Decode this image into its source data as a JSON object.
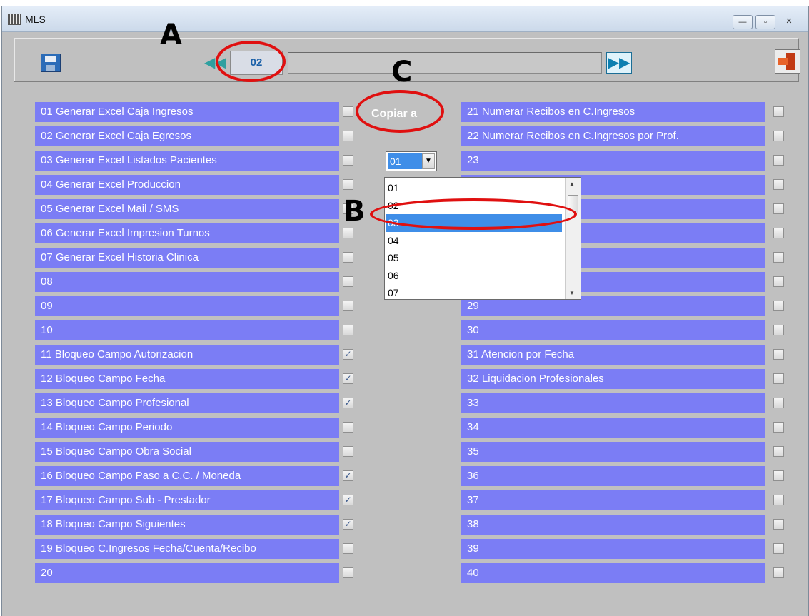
{
  "window": {
    "title": "MLS",
    "minimize_glyph": "—",
    "maximize_glyph": "▫",
    "close_glyph": "✕"
  },
  "toolbar": {
    "record": "02",
    "prev_glyph": "◀◀",
    "next_glyph": "▶▶",
    "icons": {
      "save": "save-icon",
      "prev": "rewind-icon",
      "next": "fast-forward-icon",
      "exit": "exit-door-icon"
    }
  },
  "annotations": {
    "a": "A",
    "b": "B",
    "c": "C",
    "color": "#e01010"
  },
  "copy": {
    "label": "Copiar a",
    "selected": "01",
    "options": [
      "01",
      "02",
      "03",
      "04",
      "05",
      "06",
      "07"
    ],
    "highlighted_option": "03"
  },
  "left_items": [
    {
      "label": "01 Generar Excel Caja Ingresos",
      "checked": false
    },
    {
      "label": "02 Generar Excel Caja Egresos",
      "checked": false
    },
    {
      "label": "03 Generar Excel Listados Pacientes",
      "checked": false
    },
    {
      "label": "04 Generar Excel Produccion",
      "checked": false
    },
    {
      "label": "05 Generar Excel Mail / SMS",
      "checked": false
    },
    {
      "label": "06 Generar Excel Impresion Turnos",
      "checked": false
    },
    {
      "label": "07 Generar Excel Historia Clinica",
      "checked": false
    },
    {
      "label": "08",
      "checked": false
    },
    {
      "label": "09",
      "checked": false
    },
    {
      "label": "10",
      "checked": false
    },
    {
      "label": "11 Bloqueo Campo Autorizacion",
      "checked": true
    },
    {
      "label": "12 Bloqueo Campo Fecha",
      "checked": true
    },
    {
      "label": "13 Bloqueo Campo Profesional",
      "checked": true
    },
    {
      "label": "14 Bloqueo Campo Periodo",
      "checked": false
    },
    {
      "label": "15 Bloqueo Campo Obra Social",
      "checked": false
    },
    {
      "label": "16 Bloqueo Campo Paso a C.C. / Moneda",
      "checked": true
    },
    {
      "label": "17 Bloqueo Campo Sub - Prestador",
      "checked": true
    },
    {
      "label": "18 Bloqueo Campo Siguientes",
      "checked": true
    },
    {
      "label": "19 Bloqueo C.Ingresos Fecha/Cuenta/Recibo",
      "checked": false
    },
    {
      "label": "20",
      "checked": false
    }
  ],
  "right_items": [
    {
      "label": "21 Numerar Recibos en C.Ingresos",
      "checked": false
    },
    {
      "label": "22 Numerar Recibos en C.Ingresos por Prof.",
      "checked": false
    },
    {
      "label": "23",
      "checked": false
    },
    {
      "label": "",
      "checked": false
    },
    {
      "label": "",
      "checked": false
    },
    {
      "label": "",
      "checked": false
    },
    {
      "label": "",
      "checked": false
    },
    {
      "label": "",
      "checked": false
    },
    {
      "label": "29",
      "checked": false
    },
    {
      "label": "30",
      "checked": false
    },
    {
      "label": "31 Atencion por Fecha",
      "checked": false
    },
    {
      "label": "32 Liquidacion Profesionales",
      "checked": false
    },
    {
      "label": "33",
      "checked": false
    },
    {
      "label": "34",
      "checked": false
    },
    {
      "label": "35",
      "checked": false
    },
    {
      "label": "36",
      "checked": false
    },
    {
      "label": "37",
      "checked": false
    },
    {
      "label": "38",
      "checked": false
    },
    {
      "label": "39",
      "checked": false
    },
    {
      "label": "40",
      "checked": false
    }
  ],
  "check_glyph": "✓",
  "row_color": "#7b7df5"
}
